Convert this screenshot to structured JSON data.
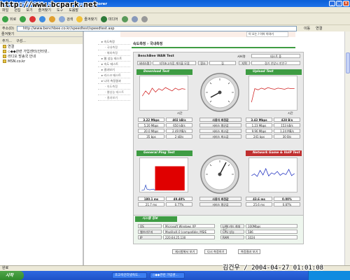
{
  "window": {
    "title": "초고속인터넷속도측정 - Microsoft Internet Explorer"
  },
  "watermark": "http://www.bcpark.net",
  "capture_stamp": "김건우 / 2004-04-27 01:01:08",
  "menu": [
    "파일",
    "편집",
    "보기",
    "즐겨찾기",
    "도구",
    "도움말"
  ],
  "toolbar": {
    "back": "뒤로",
    "search": "검색",
    "favorites": "즐겨찾기",
    "media": "미디어"
  },
  "address": {
    "label": "주소(D)",
    "url": "http://www.benchbee.co.kr/speedtest/speedtest.asp",
    "go": "이동",
    "links": "연결"
  },
  "sidebar": {
    "header": "즐겨찾기",
    "add": "추가...",
    "organize": "구성...",
    "items": [
      "연결",
      "◇◆◆관련 가입센터(인터넷..",
      "라디오 방송국 안내",
      "MSN.co.kr"
    ]
  },
  "statusbar": {
    "text": "완료"
  },
  "taskbar": {
    "start": "시작",
    "tasks": [
      "초고속인터넷속도..",
      "◇◆◆관련 가입센..."
    ]
  },
  "page": {
    "breadcrumb": "속도측정 › 국내측정",
    "top_right": "이 오는 / 이어 이야기",
    "left_nav": [
      {
        "label": "속도측정",
        "sub": false
      },
      {
        "label": "국내측정",
        "sub": true
      },
      {
        "label": "해외측정",
        "sub": true
      },
      {
        "label": "웹 성능 테스트",
        "sub": false
      },
      {
        "label": "속도 테스트",
        "sub": false
      },
      {
        "label": "결과보기",
        "sub": false
      },
      {
        "label": "리스크 테스트",
        "sub": false
      },
      {
        "label": "나의 측정결과",
        "sub": false
      },
      {
        "label": "속도측정",
        "sub": true
      },
      {
        "label": "웹성능 테스트",
        "sub": true
      },
      {
        "label": "결과보기",
        "sub": true
      }
    ],
    "wan": {
      "title": "BenchBee WAN Test",
      "server_label": "서버명",
      "server_value": "테스트 중",
      "service_label": "서비스명",
      "service_value": "지역초고속망 케이블 모뎀",
      "place_label": "장소",
      "place_value": "집",
      "area_label": "지역",
      "area_value": "경기 안양시 만안구"
    },
    "download": {
      "title": "Download Test",
      "time_label": "시간",
      "rows": [
        [
          "3.22 Mbps",
          "402 kB/s"
        ],
        [
          "5.20 Mbps",
          "650 kB/s"
        ],
        [
          "20.0 Mbps",
          "2.49 MB/s"
        ],
        [
          "35 bps",
          "2 kB/s"
        ]
      ]
    },
    "upload": {
      "title": "Upload Test",
      "time_label": "시간",
      "rows": [
        [
          "3.43 Mbps",
          "428 B/s"
        ],
        [
          "1.23 Mbps",
          "153 kB/s"
        ],
        [
          "9.96 Mbps",
          "1.24 MB/s"
        ],
        [
          "241 bps",
          "30 B/s"
        ]
      ]
    },
    "center_labels": [
      "사용자 측정값",
      "서비스 평균값",
      "서비스 최고값",
      "서비스 최소값"
    ],
    "ping": {
      "title": "General Ping Test",
      "rows": [
        [
          "180.1 ms",
          "49.40%"
        ],
        [
          "21.7 ms",
          "0.77%"
        ]
      ]
    },
    "network": {
      "title": "Network Game & VoIP Test",
      "rows": [
        [
          "43.6 ms",
          "0.00%"
        ],
        [
          "25.6 ms",
          "0.87%"
        ]
      ]
    },
    "ping_center": [
      "사용자 측정값",
      "서비스 평균값"
    ],
    "system": {
      "title": "시스템 정보",
      "left": [
        [
          "OS",
          "Microsoft Windows XP"
        ],
        [
          "웹브라우저",
          "Mozilla/4.0 (compatible; MSIE"
        ],
        [
          "IP",
          "220.64.25.130"
        ]
      ],
      "right": [
        [
          "LAN 카드 최대 속도",
          "100Mbps"
        ],
        [
          "CPU 성능",
          "586"
        ],
        [
          "RAM",
          "1024"
        ]
      ]
    },
    "buttons": [
      "재시험해서 보기",
      "다시 측정하기",
      "측정결과 보기"
    ]
  },
  "colors": {
    "green": "#3e9c43",
    "red": "#e00000",
    "titlebar": "#0a5fd8"
  },
  "chart_data": [
    {
      "type": "line",
      "title": "Download Test",
      "series": [
        {
          "values": [
            2.1,
            3.0,
            2.4,
            3.5,
            2.8,
            3.4,
            3.1,
            3.6,
            3.3,
            3.0,
            3.5,
            3.2,
            3.4,
            3.3
          ]
        }
      ]
    },
    {
      "type": "line",
      "title": "Upload Test",
      "series": [
        {
          "values": [
            1.0,
            3.4,
            3.2,
            3.5,
            3.3,
            3.6,
            3.4,
            3.3,
            3.5,
            3.4,
            3.3,
            3.5,
            3.4,
            3.4
          ]
        }
      ]
    },
    {
      "type": "line",
      "title": "Network Game & VoIP Test",
      "series": [
        {
          "values": [
            40,
            45,
            38,
            55,
            42,
            60,
            39,
            48,
            44,
            52,
            41,
            47,
            43,
            58,
            40,
            46
          ]
        }
      ]
    }
  ]
}
